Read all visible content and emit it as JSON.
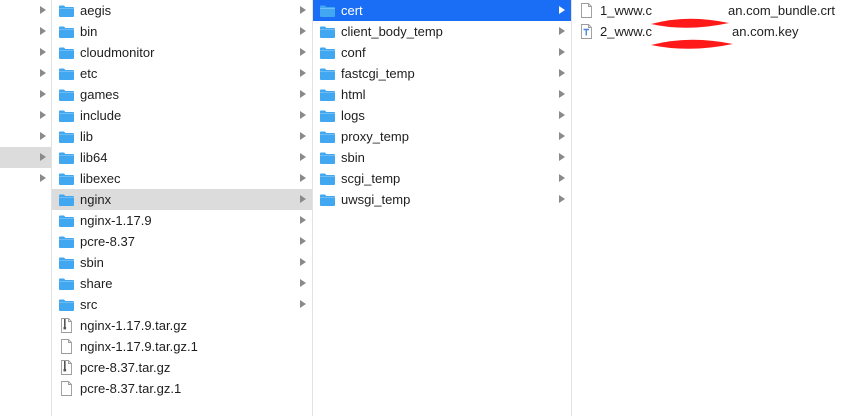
{
  "prev_column": {
    "row_count": 19,
    "highlighted_row": 7
  },
  "column1": {
    "items": [
      {
        "label": "aegis",
        "kind": "folder"
      },
      {
        "label": "bin",
        "kind": "folder"
      },
      {
        "label": "cloudmonitor",
        "kind": "folder"
      },
      {
        "label": "etc",
        "kind": "folder"
      },
      {
        "label": "games",
        "kind": "folder"
      },
      {
        "label": "include",
        "kind": "folder"
      },
      {
        "label": "lib",
        "kind": "folder"
      },
      {
        "label": "lib64",
        "kind": "folder"
      },
      {
        "label": "libexec",
        "kind": "folder"
      },
      {
        "label": "nginx",
        "kind": "folder",
        "selected": true
      },
      {
        "label": "nginx-1.17.9",
        "kind": "folder"
      },
      {
        "label": "pcre-8.37",
        "kind": "folder"
      },
      {
        "label": "sbin",
        "kind": "folder"
      },
      {
        "label": "share",
        "kind": "folder"
      },
      {
        "label": "src",
        "kind": "folder"
      },
      {
        "label": "nginx-1.17.9.tar.gz",
        "kind": "archive"
      },
      {
        "label": "nginx-1.17.9.tar.gz.1",
        "kind": "file"
      },
      {
        "label": "pcre-8.37.tar.gz",
        "kind": "archive"
      },
      {
        "label": "pcre-8.37.tar.gz.1",
        "kind": "file"
      }
    ]
  },
  "column2": {
    "items": [
      {
        "label": "cert",
        "kind": "folder",
        "selected": true
      },
      {
        "label": "client_body_temp",
        "kind": "folder"
      },
      {
        "label": "conf",
        "kind": "folder"
      },
      {
        "label": "fastcgi_temp",
        "kind": "folder"
      },
      {
        "label": "html",
        "kind": "folder"
      },
      {
        "label": "logs",
        "kind": "folder"
      },
      {
        "label": "proxy_temp",
        "kind": "folder"
      },
      {
        "label": "sbin",
        "kind": "folder"
      },
      {
        "label": "scgi_temp",
        "kind": "folder"
      },
      {
        "label": "uwsgi_temp",
        "kind": "folder"
      }
    ]
  },
  "column3": {
    "items": [
      {
        "label_start": "1_www.c",
        "label_end": "an.com_bundle.crt",
        "kind": "file"
      },
      {
        "label_start": "2_www.c",
        "label_end": "an.com.key",
        "kind": "text-file"
      }
    ]
  },
  "colors": {
    "folder": "#41a7f0",
    "selection_blue": "#1a6ef5",
    "selection_gray": "#dcdcdc",
    "redaction": "#ff1a1a"
  }
}
